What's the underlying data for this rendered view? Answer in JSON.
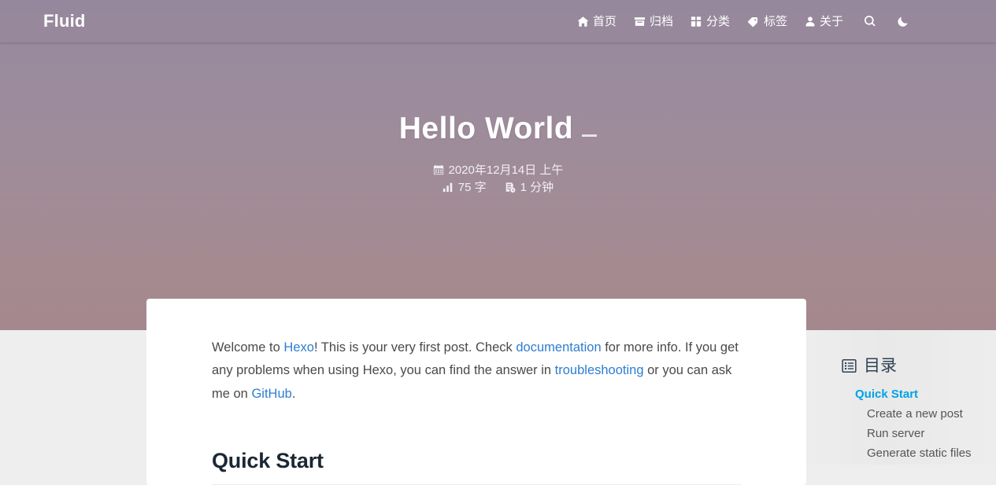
{
  "site": {
    "brand": "Fluid"
  },
  "nav": {
    "items": [
      {
        "label": "首页",
        "icon": "home-icon"
      },
      {
        "label": "归档",
        "icon": "archive-icon"
      },
      {
        "label": "分类",
        "icon": "categories-icon"
      },
      {
        "label": "标签",
        "icon": "tag-icon"
      },
      {
        "label": "关于",
        "icon": "user-icon"
      }
    ],
    "tools": [
      {
        "name": "search-icon",
        "label": "搜索"
      },
      {
        "name": "dark-mode-icon",
        "label": "夜间模式"
      }
    ]
  },
  "banner": {
    "title": "Hello World",
    "meta": {
      "date_icon": "calendar-icon",
      "date": "2020年12月14日 上午",
      "wordcount_icon": "chart-icon",
      "wordcount": "75 字",
      "readtime_icon": "clock-doc-icon",
      "readtime": "1 分钟"
    }
  },
  "post": {
    "intro": {
      "t1": "Welcome to ",
      "link_hexo": "Hexo",
      "t2": "! This is your very first post. Check ",
      "link_doc": "documentation",
      "t3": " for more info. If you get any problems when using Hexo, you can find the answer in ",
      "link_trouble": "troubleshooting",
      "t4": " or you can ask me on ",
      "link_github": "GitHub",
      "t5": "."
    },
    "heading_quick_start": "Quick Start"
  },
  "toc": {
    "icon": "list-icon",
    "title": "目录",
    "items": [
      {
        "label": "Quick Start",
        "level": 1,
        "active": true
      },
      {
        "label": "Create a new post",
        "level": 2,
        "active": false
      },
      {
        "label": "Run server",
        "level": 2,
        "active": false
      },
      {
        "label": "Generate static files",
        "level": 2,
        "active": false
      }
    ]
  },
  "colors": {
    "navbar": "#9a8a9d",
    "banner_top": "#97899f",
    "banner_bottom": "#a4888d",
    "link": "#2d7dd2",
    "toc_active": "#00a2e8",
    "page_bg": "#eeeeee"
  }
}
